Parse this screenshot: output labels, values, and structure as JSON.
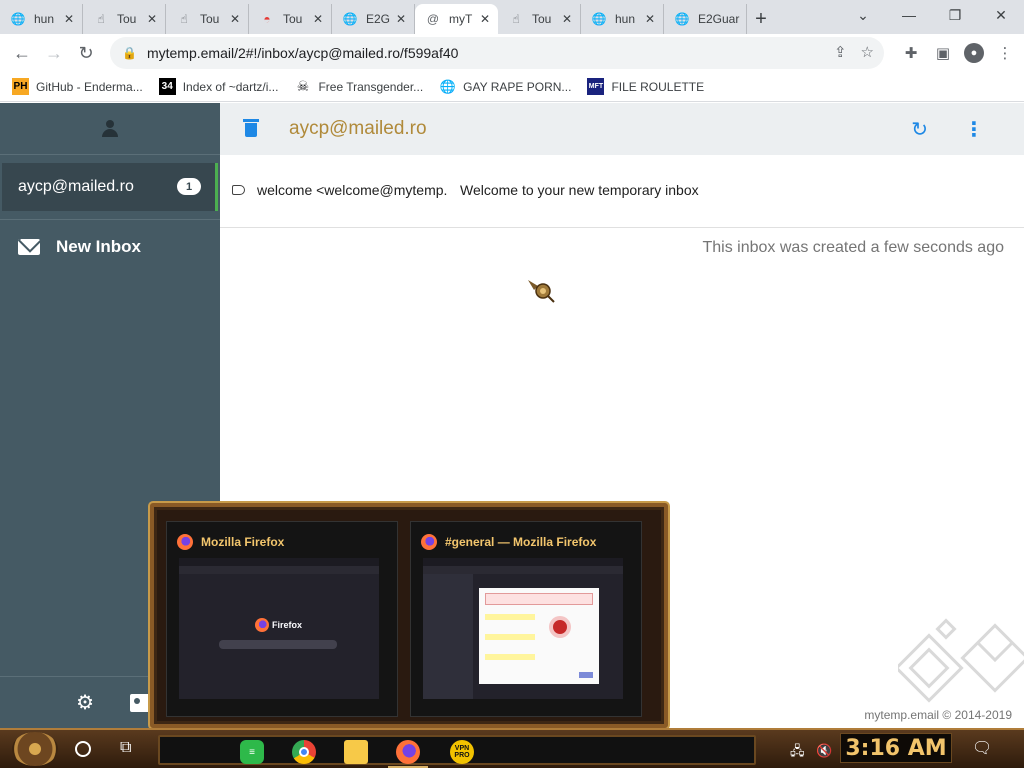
{
  "tabs": [
    {
      "title": "hun",
      "icon": "globe-icon"
    },
    {
      "title": "Tou",
      "icon": "hand-icon"
    },
    {
      "title": "Tou",
      "icon": "hand-icon"
    },
    {
      "title": "Tou",
      "icon": "rainbow-icon"
    },
    {
      "title": "E2G",
      "icon": "globe-icon"
    },
    {
      "title": "myT",
      "icon": "at-icon",
      "active": true
    },
    {
      "title": "Tou",
      "icon": "hand-icon"
    },
    {
      "title": "hun",
      "icon": "globe-icon"
    },
    {
      "title": "E2Guar",
      "icon": "globe-icon"
    }
  ],
  "address_bar": {
    "url": "mytemp.email/2#!/inbox/aycp@mailed.ro/f599af40"
  },
  "bookmarks": [
    {
      "label": "GitHub - Enderma...",
      "icon": "PH"
    },
    {
      "label": "Index of ~dartz/i...",
      "icon": "34"
    },
    {
      "label": "Free Transgender...",
      "icon": "skull"
    },
    {
      "label": "GAY RAPE PORN...",
      "icon": "globe"
    },
    {
      "label": "FILE ROULETTE",
      "icon": "MFT"
    }
  ],
  "sidebar": {
    "inbox_address": "aycp@mailed.ro",
    "inbox_count": "1",
    "new_inbox_label": "New Inbox"
  },
  "main": {
    "title": "aycp@mailed.ro",
    "message": {
      "sender": "welcome <welcome@mytemp.email>",
      "subject": "Welcome to your new temporary inbox"
    },
    "created_note": "This inbox was created a few seconds ago",
    "footer": "mytemp.email © 2014-2019"
  },
  "switcher": {
    "windows": [
      {
        "title": "Mozilla Firefox",
        "thumb_logo": "Firefox"
      },
      {
        "title": "#general — Mozilla Firefox"
      }
    ]
  },
  "taskbar": {
    "clock": "3:16 AM",
    "vpn_label": "VPN PRO"
  },
  "colors": {
    "sidebar_bg": "#455a64",
    "accent_blue": "#1e88e5",
    "title_gold": "#b08a3a",
    "active_green": "#4caf50"
  }
}
